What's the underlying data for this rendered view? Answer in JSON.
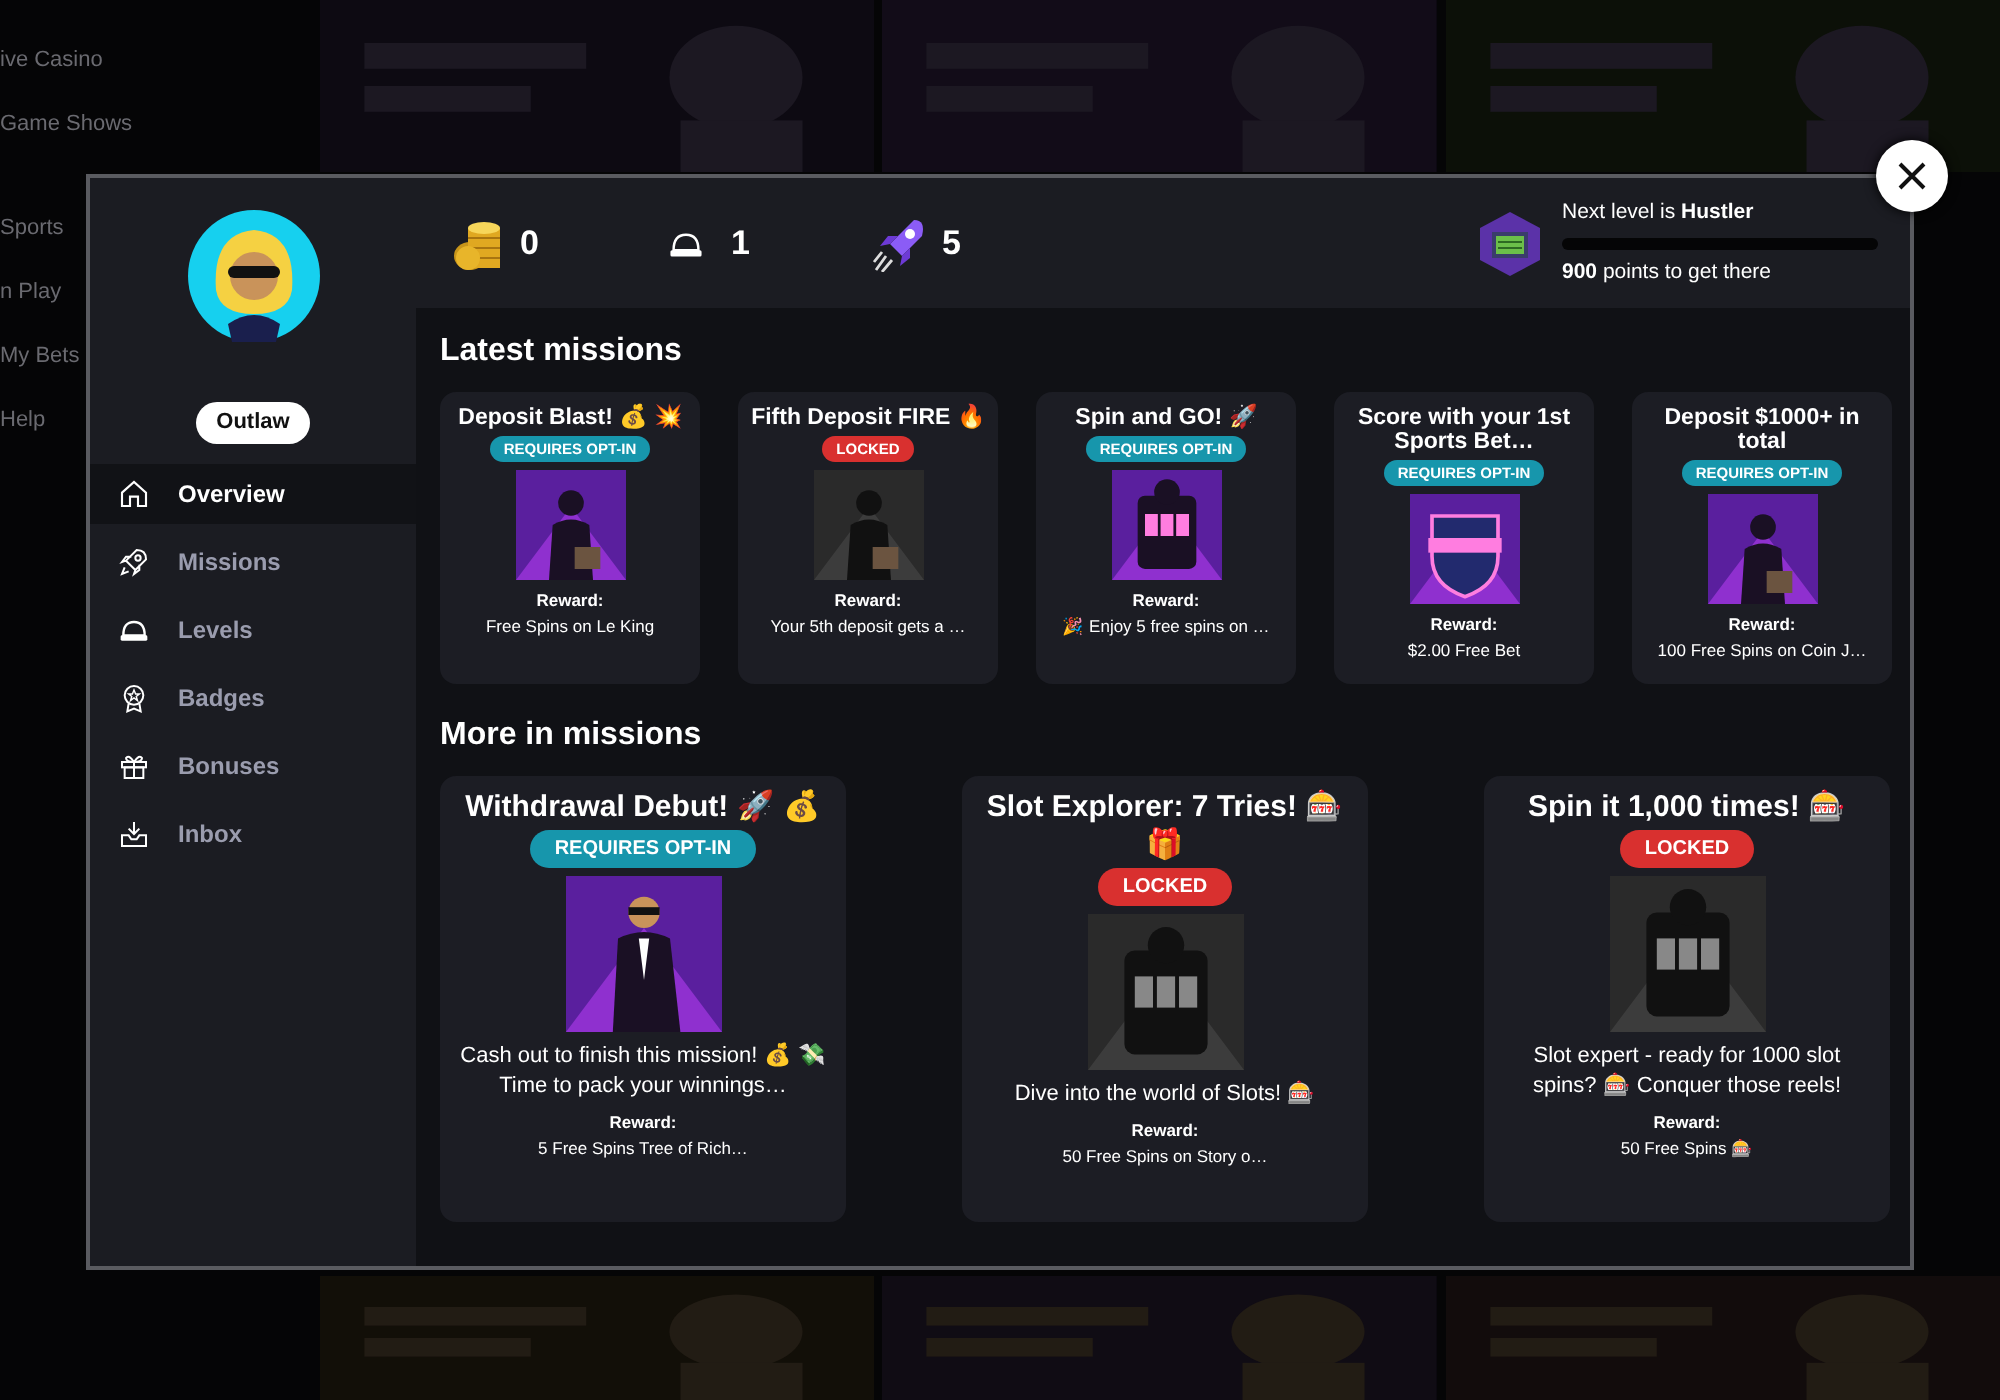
{
  "background": {
    "menu": [
      "ive Casino",
      "Game Shows",
      "Sports",
      "n Play",
      "My Bets",
      "Help"
    ]
  },
  "profile": {
    "rank": "Outlaw"
  },
  "nav": [
    {
      "kind": "home",
      "label": "Overview",
      "selected": true
    },
    {
      "kind": "rocket",
      "label": "Missions",
      "selected": false
    },
    {
      "kind": "helmet",
      "label": "Levels",
      "selected": false
    },
    {
      "kind": "badge",
      "label": "Badges",
      "selected": false
    },
    {
      "kind": "gift",
      "label": "Bonuses",
      "selected": false
    },
    {
      "kind": "inbox",
      "label": "Inbox",
      "selected": false
    }
  ],
  "stats": [
    {
      "kind": "coins",
      "value": "0"
    },
    {
      "kind": "helmet",
      "value": "1"
    },
    {
      "kind": "rocket",
      "value": "5"
    }
  ],
  "next_level": {
    "text": "Next level is **Hustler**",
    "level": 0,
    "points": "**900** points to get there"
  },
  "latest": {
    "title": "Latest missions",
    "cards": [
      {
        "title": "Deposit Blast! 💰 💥",
        "kind": "opt_in",
        "badge": "REQUIRES OPT-IN",
        "reward_label": "Reward:",
        "reward": "Free Spins on Le King"
      },
      {
        "title": "Fifth Deposit FIRE 🔥",
        "kind": "locked",
        "badge": "LOCKED",
        "reward_label": "Reward:",
        "reward": "Your 5th deposit gets a …"
      },
      {
        "title": "Spin and GO! 🚀",
        "kind": "opt_in",
        "badge": "REQUIRES OPT-IN",
        "reward_label": "Reward:",
        "reward": "🎉 Enjoy 5 free spins on …"
      },
      {
        "title": "Score with your 1st Sports Bet…",
        "kind": "opt_in",
        "badge": "REQUIRES OPT-IN",
        "reward_label": "Reward:",
        "reward": "$2.00 Free Bet"
      },
      {
        "title": "Deposit $1000+ in total",
        "kind": "opt_in",
        "badge": "REQUIRES OPT-IN",
        "reward_label": "Reward:",
        "reward": "100 Free Spins on Coin J…"
      }
    ]
  },
  "more": {
    "title": "More in missions",
    "cards": [
      {
        "title": "Withdrawal Debut! 🚀 💰",
        "kind": "opt_in",
        "badge": "REQUIRES OPT-IN",
        "description": "Cash out to finish this mission! 💰 💸 Time to pack your winnings…",
        "reward_label": "Reward:",
        "reward": "5 Free Spins Tree of Rich…"
      },
      {
        "title": "Slot Explorer: 7 Tries! 🎰 🎁",
        "kind": "locked",
        "badge": "LOCKED",
        "description": "Dive into the world of Slots! 🎰",
        "reward_label": "Reward:",
        "reward": "50 Free Spins on Story o…"
      },
      {
        "title": "Spin it 1,000 times! 🎰",
        "kind": "locked",
        "badge": "LOCKED",
        "description": "Slot expert - ready for 1000 slot spins? 🎰 Conquer those reels!",
        "reward_label": "Reward:",
        "reward": "50 Free Spins 🎰"
      }
    ]
  }
}
